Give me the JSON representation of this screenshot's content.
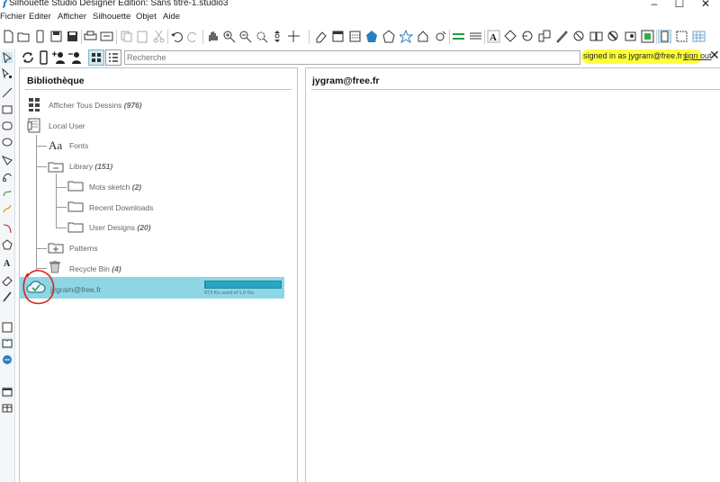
{
  "window": {
    "title": "Silhouette Studio Designer Edition: Sans titre-1.studio3",
    "controls": [
      "–",
      "☐",
      "✕"
    ]
  },
  "menu": [
    "Fichier",
    "Editer",
    "Afficher",
    "Silhouette",
    "Objet",
    "Aide"
  ],
  "toolbar_icons": [
    "new-icon",
    "open-icon",
    "phone-icon",
    "save-icon",
    "save-as-icon",
    "print-icon",
    "send-icon",
    "copy-icon",
    "paste-icon",
    "cut-icon",
    "undo-icon",
    "redo-icon",
    "pan-icon",
    "zoom-in-icon",
    "zoom-out-icon",
    "zoom-select-icon",
    "zoom-fit-icon",
    "move-icon",
    "eraser-icon",
    "page-setup-icon",
    "grid-icon",
    "fill-icon",
    "shape-icon",
    "star-icon",
    "house-icon",
    "settings-icon",
    "line-color-icon",
    "line-style-icon",
    "text-style-icon",
    "transform-icon",
    "replicate-icon",
    "offset-icon",
    "knife-icon",
    "trace-icon",
    "modify-icon",
    "pixscan-icon",
    "send-to-icon",
    "design-store-icon",
    "library-icon",
    "studio-icon",
    "layers-icon"
  ],
  "library_bar": {
    "search_placeholder": "Recherche",
    "signed_in_text": "signed in as jygram@free.fr",
    "separator": "|",
    "sign_out": "sign out",
    "close": "✕"
  },
  "library_panel": {
    "title": "Bibliothèque",
    "items": [
      {
        "label": "Afficher Tous Dessins",
        "count": "(976)"
      },
      {
        "label": "Local User",
        "count": ""
      },
      {
        "label": "Fonts",
        "count": ""
      },
      {
        "label": "Library",
        "count": "(151)"
      },
      {
        "label": "Mots sketch",
        "count": "(2)"
      },
      {
        "label": "Recent Downloads",
        "count": ""
      },
      {
        "label": "User Designs",
        "count": "(20)"
      },
      {
        "label": "Patterns",
        "count": ""
      },
      {
        "label": "Recycle Bin",
        "count": "(4)"
      }
    ],
    "cloud": {
      "user": "jygram@free.fr",
      "quota_text": "973 Ko used of 1.0 Go",
      "quota_fraction": 0.001
    }
  },
  "right_panel": {
    "title": "jygram@free.fr"
  },
  "colors": {
    "highlight": "#ffff3c",
    "cloud_row": "#8fd6e4",
    "quota": "#2aa6c2",
    "annotation": "#e02020"
  }
}
